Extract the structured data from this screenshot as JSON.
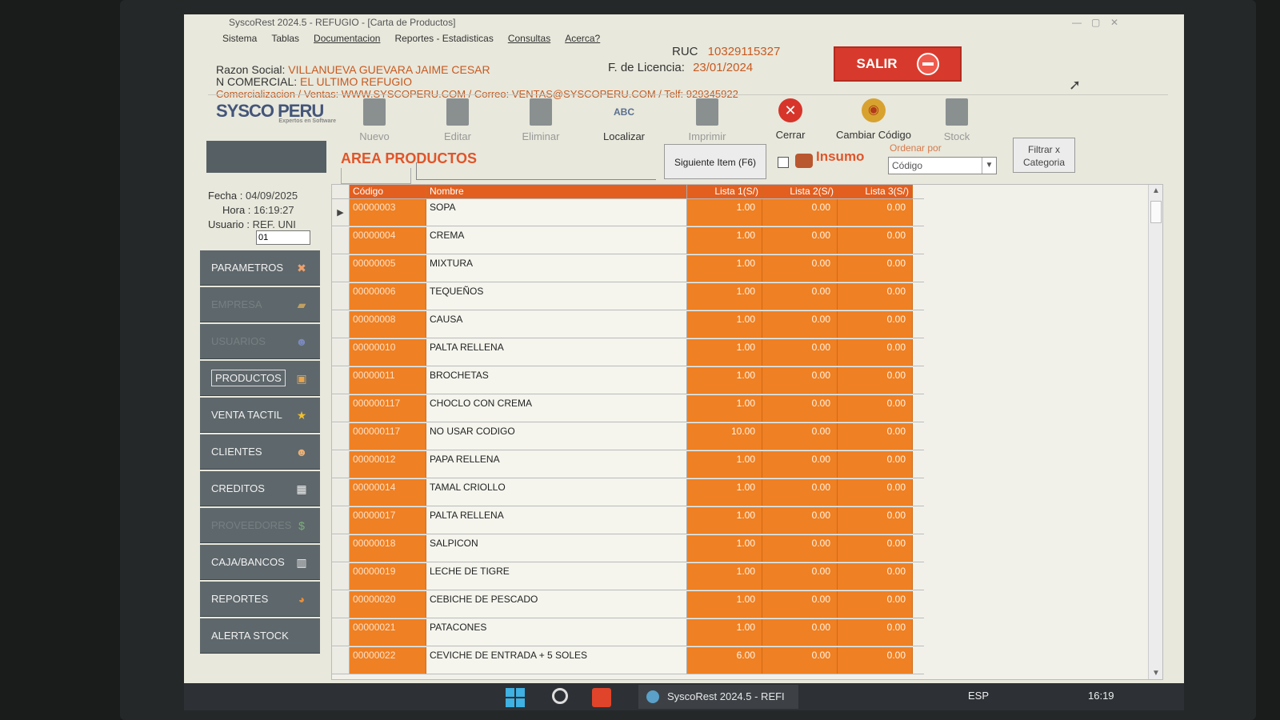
{
  "window": {
    "title": "SyscoRest 2024.5 - REFUGIO - [Carta de Productos]",
    "controls": [
      "—",
      "▢",
      "✕"
    ]
  },
  "menu": [
    "Sistema",
    "Tablas",
    "Documentacion",
    "Reportes - Estadisticas",
    "Consultas",
    "Acerca?"
  ],
  "company": {
    "razon_label": "Razon Social:",
    "razon_value": "VILLANUEVA GUEVARA JAIME CESAR",
    "comercial_label": "N COMERCIAL:",
    "comercial_value": "EL ULTIMO REFUGIO",
    "ventas_line": "Comercializacion / Ventas: WWW.SYSCOPERU.COM / Correo: VENTAS@SYSCOPERU.COM / Telf: 929345922",
    "ruc_label": "RUC",
    "ruc_value": "10329115327",
    "licencia_label": "F. de Licencia:",
    "licencia_value": "23/01/2024",
    "salir_label": "SALIR"
  },
  "brand": {
    "logo": "SYSCO PERU",
    "tagline": "Expertos en Software"
  },
  "session": {
    "fecha_label": "Fecha :",
    "fecha": "04/09/2025",
    "hora_label": "Hora :",
    "hora": "16:19:27",
    "usuario_label": "Usuario :",
    "usuario": "REF. UNI",
    "usuario_code": "01"
  },
  "sidebar": [
    {
      "label": "PARAMETROS",
      "icon": "wrench-icon",
      "dim": false
    },
    {
      "label": "EMPRESA",
      "icon": "building-icon",
      "dim": true
    },
    {
      "label": "USUARIOS",
      "icon": "users-icon",
      "dim": true
    },
    {
      "label": "PRODUCTOS",
      "icon": "box-icon",
      "dim": false,
      "boxed": true
    },
    {
      "label": "VENTA TACTIL",
      "icon": "star-icon",
      "dim": false
    },
    {
      "label": "CLIENTES",
      "icon": "clients-icon",
      "dim": false
    },
    {
      "label": "CREDITOS",
      "icon": "calendar-icon",
      "dim": false
    },
    {
      "label": "PROVEEDORES",
      "icon": "suppliers-icon",
      "dim": true
    },
    {
      "label": "CAJA/BANCOS",
      "icon": "cash-icon",
      "dim": false
    },
    {
      "label": "REPORTES",
      "icon": "pie-chart-icon",
      "dim": false
    },
    {
      "label": "ALERTA STOCK",
      "icon": "",
      "dim": false
    }
  ],
  "toolbar": [
    {
      "label": "Nuevo",
      "icon": "new-doc-icon",
      "active": false
    },
    {
      "label": "Editar",
      "icon": "edit-icon",
      "active": false
    },
    {
      "label": "Eliminar",
      "icon": "delete-icon",
      "active": false
    },
    {
      "label": "Localizar",
      "icon": "search-abc-icon",
      "active": true
    },
    {
      "label": "Imprimir",
      "icon": "print-icon",
      "active": false
    },
    {
      "label": "Cerrar",
      "icon": "close-icon",
      "active": true
    },
    {
      "label": "Cambiar Código",
      "icon": "globe-icon",
      "active": true
    },
    {
      "label": "Stock",
      "icon": "stock-icon",
      "active": false
    }
  ],
  "area": {
    "title": "AREA PRODUCTOS",
    "siguiente": "Siguiente Item (F6)",
    "insumo": "Insumo",
    "ordenar_label": "Ordenar por",
    "ordenar_value": "Código",
    "filtrar": "Filtrar x Categoria"
  },
  "table": {
    "headers": [
      "Código",
      "Nombre",
      "Lista 1(S/)",
      "Lista 2(S/)",
      "Lista 3(S/)"
    ],
    "rows": [
      [
        "00000003",
        "SOPA",
        "1.00",
        "0.00",
        "0.00"
      ],
      [
        "00000004",
        "CREMA",
        "1.00",
        "0.00",
        "0.00"
      ],
      [
        "00000005",
        "MIXTURA",
        "1.00",
        "0.00",
        "0.00"
      ],
      [
        "00000006",
        "TEQUEÑOS",
        "1.00",
        "0.00",
        "0.00"
      ],
      [
        "00000008",
        "CAUSA",
        "1.00",
        "0.00",
        "0.00"
      ],
      [
        "00000010",
        "PALTA RELLENA",
        "1.00",
        "0.00",
        "0.00"
      ],
      [
        "00000011",
        "BROCHETAS",
        "1.00",
        "0.00",
        "0.00"
      ],
      [
        "000000117",
        "CHOCLO CON CREMA",
        "1.00",
        "0.00",
        "0.00"
      ],
      [
        "000000117",
        "NO USAR CODIGO",
        "10.00",
        "0.00",
        "0.00"
      ],
      [
        "00000012",
        "PAPA RELLENA",
        "1.00",
        "0.00",
        "0.00"
      ],
      [
        "00000014",
        "TAMAL CRIOLLO",
        "1.00",
        "0.00",
        "0.00"
      ],
      [
        "00000017",
        "PALTA RELLENA",
        "1.00",
        "0.00",
        "0.00"
      ],
      [
        "00000018",
        "SALPICON",
        "1.00",
        "0.00",
        "0.00"
      ],
      [
        "00000019",
        "LECHE DE TIGRE",
        "1.00",
        "0.00",
        "0.00"
      ],
      [
        "00000020",
        "CEBICHE DE PESCADO",
        "1.00",
        "0.00",
        "0.00"
      ],
      [
        "00000021",
        "PATACONES",
        "1.00",
        "0.00",
        "0.00"
      ],
      [
        "00000022",
        "CEVICHE DE ENTRADA + 5 SOLES",
        "6.00",
        "0.00",
        "0.00"
      ]
    ]
  },
  "taskbar": {
    "app_label": "SyscoRest 2024.5 - REFI",
    "lang": "ESP",
    "clock": "16:19"
  },
  "colors": {
    "accent": "#e25f1f",
    "column": "#ef8023",
    "salir": "#d73a2c",
    "sidebar": "#5e676b"
  }
}
